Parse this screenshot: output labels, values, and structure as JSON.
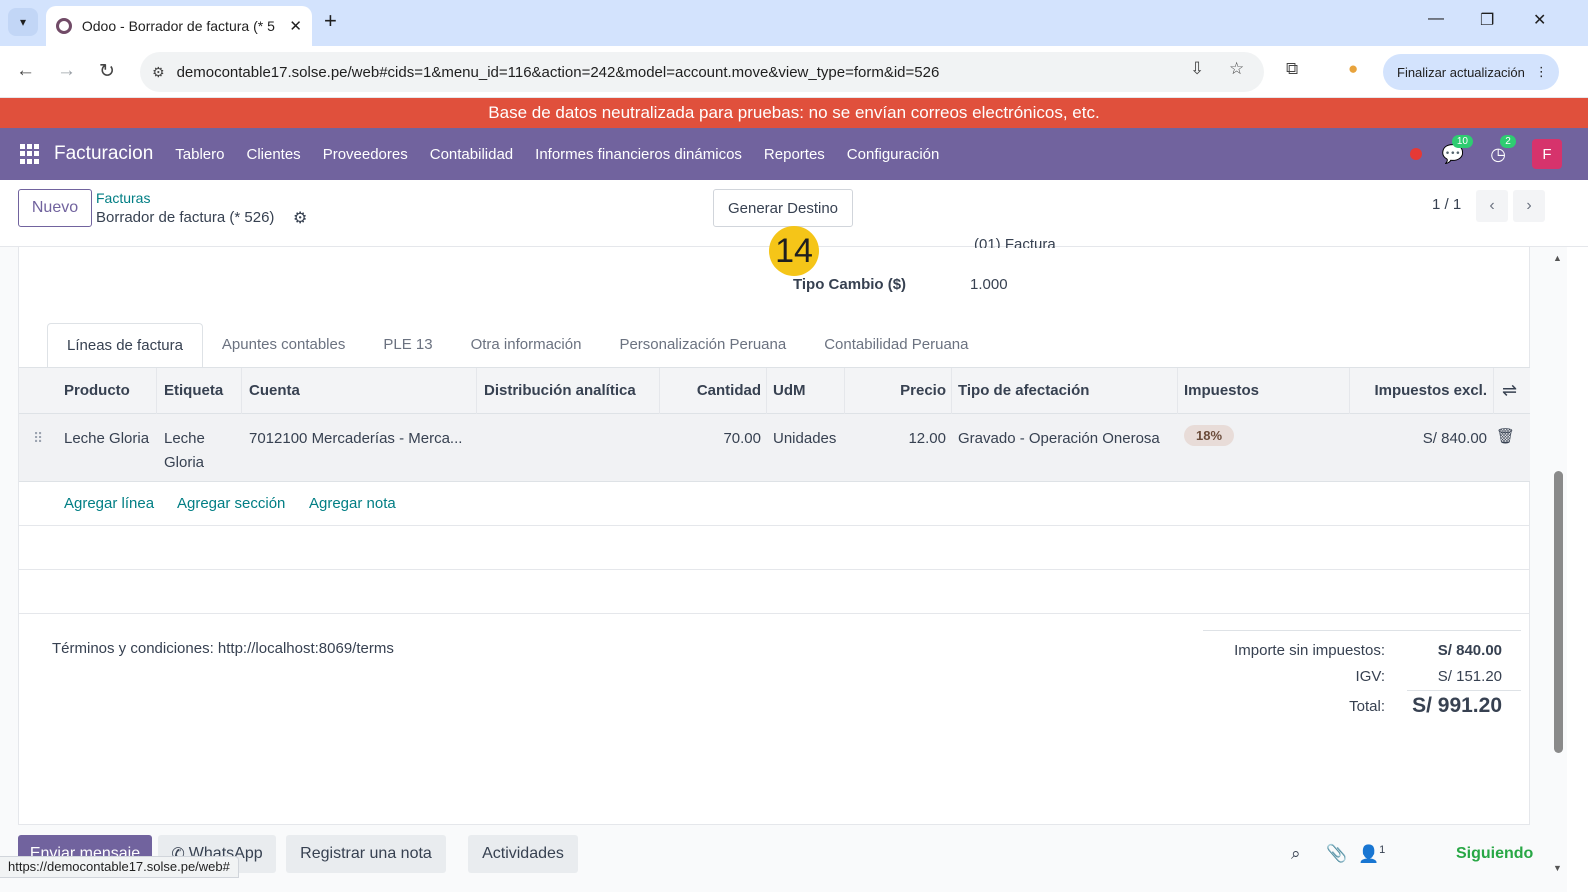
{
  "browser": {
    "tab_title": "Odoo - Borrador de factura (* 5",
    "url": "democontable17.solse.pe/web#cids=1&menu_id=116&action=242&model=account.move&view_type=form&id=526",
    "update_button": "Finalizar actualización",
    "status_url": "https://democontable17.solse.pe/web#"
  },
  "banner": "Base de datos neutralizada para pruebas: no se envían correos electrónicos, etc.",
  "nav": {
    "brand": "Facturacion",
    "menu": [
      "Tablero",
      "Clientes",
      "Proveedores",
      "Contabilidad",
      "Informes financieros dinámicos",
      "Reportes",
      "Configuración"
    ],
    "messages_count": "10",
    "activities_count": "2",
    "avatar_letter": "F"
  },
  "control_panel": {
    "new_button": "Nuevo",
    "breadcrumb_parent": "Facturas",
    "breadcrumb_current": "Borrador de factura (* 526)",
    "generate_button": "Generar Destino",
    "pager": "1 / 1"
  },
  "step_badge": "14",
  "form": {
    "partial_field": "(01) Factura",
    "exchange_label": "Tipo Cambio ($)",
    "exchange_value": "1.000"
  },
  "tabs": [
    "Líneas de factura",
    "Apuntes contables",
    "PLE 13",
    "Otra información",
    "Personalización Peruana",
    "Contabilidad Peruana"
  ],
  "table": {
    "headers": {
      "producto": "Producto",
      "etiqueta": "Etiqueta",
      "cuenta": "Cuenta",
      "analitica": "Distribución analítica",
      "cantidad": "Cantidad",
      "udm": "UdM",
      "precio": "Precio",
      "afectacion": "Tipo de afectación",
      "impuestos": "Impuestos",
      "excl": "Impuestos excl."
    },
    "row": {
      "producto": "Leche Gloria",
      "etiqueta_1": "Leche",
      "etiqueta_2": "Gloria",
      "cuenta": "7012100 Mercaderías - Merca...",
      "cantidad": "70.00",
      "udm": "Unidades",
      "precio": "12.00",
      "afectacion": "Gravado - Operación Onerosa",
      "impuesto": "18%",
      "excl": "S/ 840.00"
    },
    "add_line": "Agregar línea",
    "add_section": "Agregar sección",
    "add_note": "Agregar nota"
  },
  "terms": "Términos y condiciones: http://localhost:8069/terms",
  "totals": {
    "untaxed_label": "Importe sin impuestos:",
    "untaxed_value": "S/ 840.00",
    "igv_label": "IGV:",
    "igv_value": "S/ 151.20",
    "total_label": "Total:",
    "total_value": "S/ 991.20"
  },
  "chatter": {
    "send_message": "Enviar mensaje",
    "whatsapp": "WhatsApp",
    "log_note": "Registrar una nota",
    "activities": "Actividades",
    "followers_count": "1",
    "following": "Siguiendo"
  },
  "colors": {
    "odoo_purple": "#71639e",
    "banner_red": "#e0503c",
    "link_teal": "#017e84",
    "following_green": "#28a745",
    "badge_yellow": "#f5c518"
  }
}
